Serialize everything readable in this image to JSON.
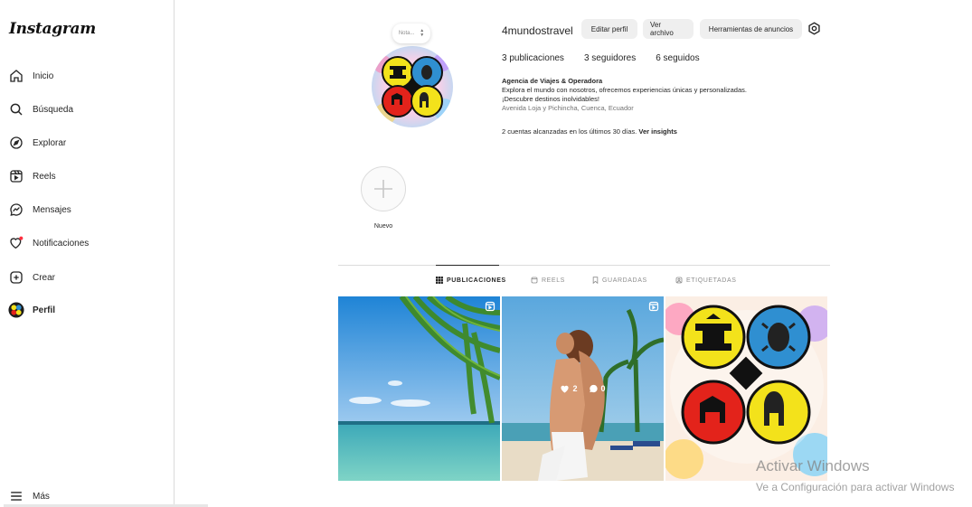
{
  "app": {
    "logo_text": "Instagram"
  },
  "sidebar": {
    "items": [
      {
        "label": "Inicio",
        "icon": "home-icon"
      },
      {
        "label": "Búsqueda",
        "icon": "search-icon"
      },
      {
        "label": "Explorar",
        "icon": "compass-icon"
      },
      {
        "label": "Reels",
        "icon": "reels-icon"
      },
      {
        "label": "Mensajes",
        "icon": "messenger-icon"
      },
      {
        "label": "Notificaciones",
        "icon": "heart-icon"
      },
      {
        "label": "Crear",
        "icon": "plus-square-icon"
      },
      {
        "label": "Perfil",
        "icon": "avatar-icon"
      }
    ],
    "more_label": "Más"
  },
  "profile": {
    "note_placeholder": "Nota...",
    "username": "4mundostravel",
    "buttons": {
      "edit": "Editar perfil",
      "archive": "Ver archivo",
      "ad_tools": "Herramientas de anuncios"
    },
    "stats": {
      "posts": "3 publicaciones",
      "followers": "3 seguidores",
      "following": "6 seguidos"
    },
    "bio": {
      "name": "Agencia de Viajes & Operadora",
      "line1": "Explora el mundo con nosotros, ofrecemos experiencias únicas y personalizadas.",
      "line2": "¡Descubre destinos inolvidables!",
      "address": "Avenida Loja y Pichincha, Cuenca, Ecuador"
    },
    "insights_text": "2 cuentas alcanzadas en los últimos 30 días.",
    "insights_link": "Ver insights"
  },
  "highlights": {
    "new_label": "Nuevo"
  },
  "tabs": [
    {
      "label": "PUBLICACIONES",
      "icon": "grid-icon",
      "active": true
    },
    {
      "label": "REELS",
      "icon": "reels-icon",
      "active": false
    },
    {
      "label": "GUARDADAS",
      "icon": "bookmark-icon",
      "active": false
    },
    {
      "label": "ETIQUETADAS",
      "icon": "tagged-icon",
      "active": false
    }
  ],
  "posts": [
    {
      "type": "reel",
      "subject": "palm leaves over turquoise sea"
    },
    {
      "type": "reel",
      "subject": "couple on a beach",
      "likes": "2",
      "comments": "0"
    },
    {
      "type": "image",
      "subject": "four circular emblems logo"
    }
  ],
  "watermark": {
    "title": "Activar Windows",
    "subtitle": "Ve a Configuración para activar Windows"
  },
  "colors": {
    "emblem_yellow": "#f3e21b",
    "emblem_blue": "#2f8fd1",
    "emblem_red": "#e3231b",
    "text_primary": "#262626",
    "button_bg": "#efefef"
  }
}
